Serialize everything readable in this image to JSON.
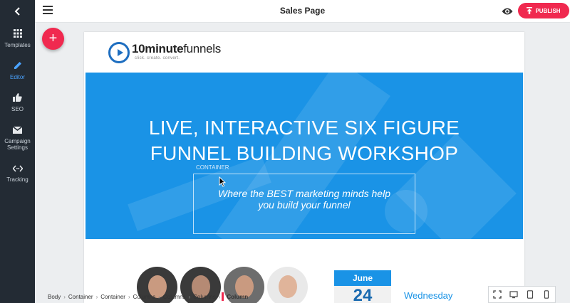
{
  "sidebar": {
    "items": [
      {
        "label": "Templates",
        "icon": "grid-icon"
      },
      {
        "label": "Editor",
        "icon": "pencil-icon"
      },
      {
        "label": "SEO",
        "icon": "thumbs-up-icon"
      },
      {
        "label": "Campaign Settings",
        "icon": "mail-icon"
      },
      {
        "label": "Tracking",
        "icon": "code-icon"
      }
    ]
  },
  "topbar": {
    "title": "Sales Page",
    "publish_label": "PUBLISH"
  },
  "fab": {
    "label": "+"
  },
  "logo": {
    "bold": "10minute",
    "rest": "funnels",
    "tagline": "click. create. convert."
  },
  "hero": {
    "title_line1": "LIVE, INTERACTIVE SIX FIGURE",
    "title_line2": "FUNNEL BUILDING WORKSHOP",
    "container_label": "CONTAINER",
    "subtitle_line1": "Where the BEST marketing minds help",
    "subtitle_line2": "you build your funnel"
  },
  "event": {
    "month": "June",
    "day": "24",
    "weekday": "Wednesday"
  },
  "breadcrumb": [
    "Body",
    "Container",
    "Container",
    "Columns",
    "Columns",
    "Columns",
    "Column"
  ],
  "colors": {
    "accent": "#f0294f",
    "sidebar": "#232b34",
    "hero": "#1a93e6",
    "active_nav": "#4aa3ff"
  }
}
